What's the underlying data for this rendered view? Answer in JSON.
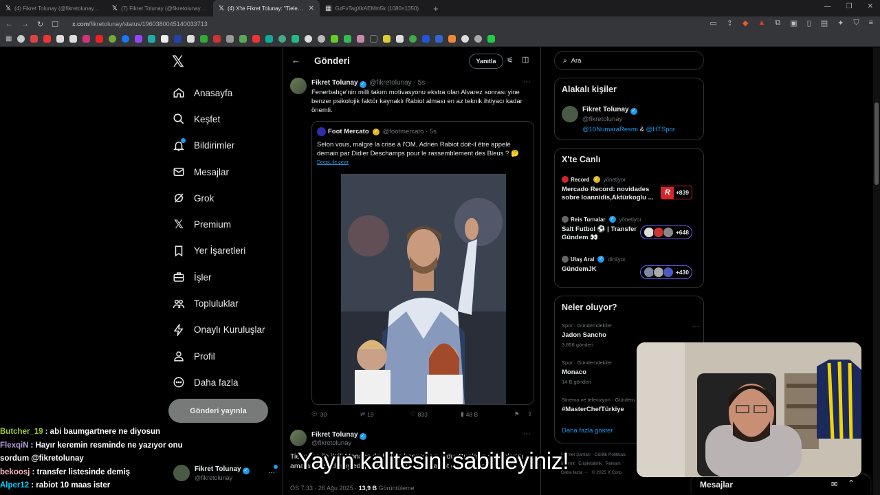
{
  "browser": {
    "tabs": [
      {
        "title": "(4) Fikret Tolunay (@fikretolunay) / X",
        "active": false
      },
      {
        "title": "(7) Fikret Tolunay (@fikretolunay) / X",
        "active": false
      },
      {
        "title": "(4) X'te Fikret Tolunay: \"Tieleman\"",
        "active": true
      },
      {
        "title": "GzFvTagXkAEMm5k (1080×1350)",
        "active": false
      }
    ],
    "url_host": "x.com",
    "url_path": "/fikretolunay/status/1960380045140033713"
  },
  "nav": {
    "items": [
      {
        "label": "Anasayfa",
        "icon": "home-icon"
      },
      {
        "label": "Keşfet",
        "icon": "search-icon"
      },
      {
        "label": "Bildirimler",
        "icon": "bell-icon"
      },
      {
        "label": "Mesajlar",
        "icon": "mail-icon"
      },
      {
        "label": "Grok",
        "icon": "grok-icon"
      },
      {
        "label": "Premium",
        "icon": "x-icon"
      },
      {
        "label": "Yer İşaretleri",
        "icon": "bookmark-icon"
      },
      {
        "label": "İşler",
        "icon": "briefcase-icon"
      },
      {
        "label": "Topluluklar",
        "icon": "people-icon"
      },
      {
        "label": "Onaylı Kuruluşlar",
        "icon": "lightning-icon"
      },
      {
        "label": "Profil",
        "icon": "person-icon"
      },
      {
        "label": "Daha fazla",
        "icon": "more-circle-icon"
      }
    ],
    "post_button": "Gönderi yayınla",
    "account": {
      "name": "Fikret Tolunay",
      "handle": "@fikretolunay"
    }
  },
  "center": {
    "title": "Gönderi",
    "reply_label": "Yanıtla",
    "tweet": {
      "name": "Fikret Tolunay",
      "handle_time": "@fikretolunay · 5s",
      "text": "Fenerbahçe'nin milli takım motivasyonu ekstra olan Alvarez sonrası yine benzer psikolojik faktör kaynaklı Rabiot alması en az teknik ihtiyacı kadar önemli.",
      "quote": {
        "name": "Foot Mercato",
        "handle_time": "@footmercato · 5s",
        "text": "Selon vous, malgré la crise à l'OM, Adrien Rabiot doit-il être appelé demain par Didier Deschamps pour le rassemblement des Bleus ? 🤔",
        "translate": "DeepL ile çevir"
      },
      "stats": {
        "replies": "30",
        "retweets": "19",
        "likes": "833",
        "views": "48 B"
      }
    },
    "tweet2": {
      "name": "Fikret Tolunay",
      "handle": "@fikretolunay",
      "text": "Tieleman ile ilgili Monaco da birkaç konuşmam oldu. Bunların ayrıntılarını ama anlatmadı söylediğim aktaryor. Bence Rabiot olar 8 de aynı.",
      "time": "ÖS 7:33 · 26 Ağu 2025 · ",
      "views": "13,9 B",
      "views_label": " Görüntüleme"
    }
  },
  "right": {
    "search_placeholder": "Ara",
    "related": {
      "title": "Alakalı kişiler",
      "name": "Fikret Tolunay",
      "handle": "@fikretolunay",
      "bio_link1": "@10NumaraResmi",
      "bio_amp": " & ",
      "bio_link2": "@HTSpor"
    },
    "live": {
      "title": "X'te Canlı",
      "items": [
        {
          "host": "Record",
          "role": "yönetiyor",
          "title": "Mercado Record: novidades sobre Ioannidis,Aktürkoglu ...",
          "count": "+839"
        },
        {
          "host": "Reis Turnalar",
          "role": "yönetiyor",
          "title": "Salt Futbol ⚽ | Transfer Gündem 👀",
          "count": "+648"
        },
        {
          "host": "Ulaş Aral",
          "role": "dinliyor",
          "title": "GündemJK",
          "count": "+430"
        }
      ]
    },
    "trends": {
      "title": "Neler oluyor?",
      "items": [
        {
          "category": "Spor · Gündemdekiler",
          "name": "Jadon Sancho",
          "count": "3.856 gönderi"
        },
        {
          "category": "Spor · Gündemdekiler",
          "name": "Monaco",
          "count": "14 B gönderi"
        },
        {
          "category": "Sinema ve televizyon · Gündem",
          "name": "#MasterChefTürkiye",
          "count": ""
        }
      ],
      "show_more": "Daha fazla göster"
    },
    "footer": [
      "Hizmet Şartları",
      "Gizlilik Politikası",
      "Imprint",
      "Erişilebilirlik",
      "Reklam",
      "Daha fazla ···",
      "© 2025 X Corp."
    ],
    "messages_label": "Mesajlar"
  },
  "chat": [
    {
      "user": "Butcher_19",
      "color": "#9acd32",
      "message": "abi baumgartnere ne diyosun"
    },
    {
      "user": "FlexqiN",
      "color": "#b19cd9",
      "message": "Hayır keremin resminde ne yazıyor onu sordum @fikretolunay"
    },
    {
      "user": "bekoosj",
      "color": "#ffb6c1",
      "message": "transfer listesinde demiş"
    },
    {
      "user": "Alper12",
      "color": "#00d2ff",
      "message": "rabiot 10 maas ister"
    }
  ],
  "subtitle": "Yayın kalitesini sabitleyiniz!"
}
